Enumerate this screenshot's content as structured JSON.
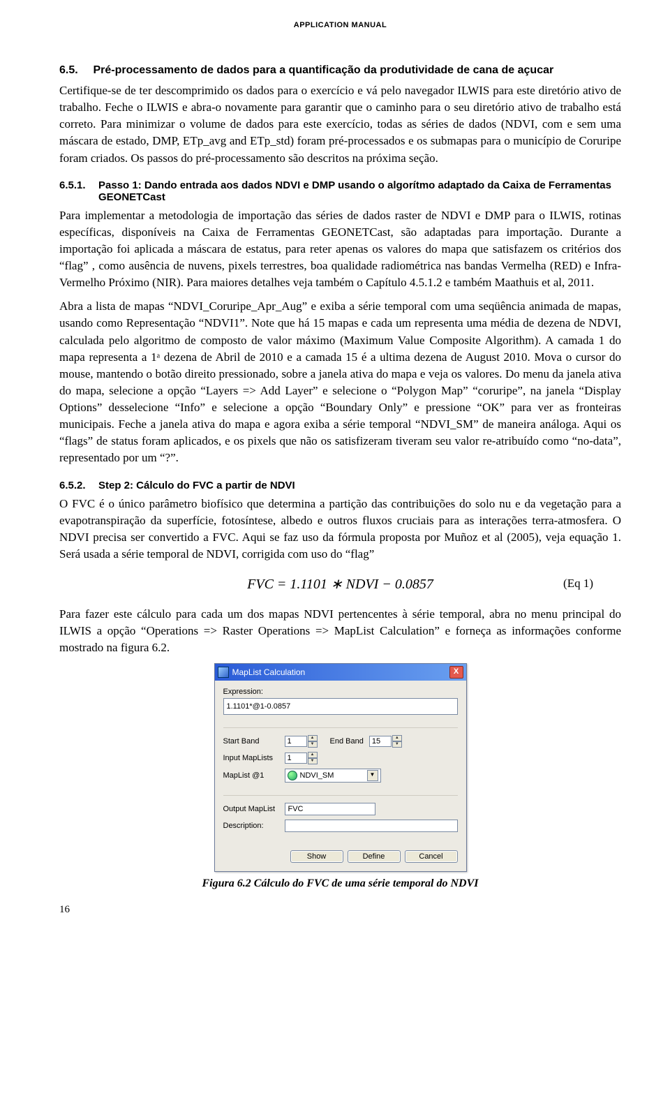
{
  "header": "APPLICATION MANUAL",
  "sec65_num": "6.5.",
  "sec65_title": "Pré-processamento de dados para a quantificação da produtividade de cana de açucar",
  "p65": "Certifique-se de ter descomprimido os dados para o exercício e vá pelo navegador ILWIS para este diretório ativo de trabalho. Feche o ILWIS e abra-o novamente para garantir que o caminho para o seu diretório ativo de trabalho está correto. Para minimizar o volume de dados para este exercício, todas as séries de dados (NDVI, com e sem uma máscara de estado, DMP, ETp_avg and ETp_std) foram pré-processados e os submapas para o município de Coruripe foram criados. Os passos do pré-processamento são descritos na próxima seção.",
  "sec651_num": "6.5.1.",
  "sec651_title": "Passo 1: Dando entrada aos dados NDVI e DMP usando o algorítmo adaptado da Caixa de Ferramentas GEONETCast",
  "p651a": "Para implementar a metodologia de importação das séries de dados raster de NDVI e DMP para o ILWIS, rotinas específicas, disponíveis na Caixa de Ferramentas GEONETCast, são adaptadas para importação. Durante a importação foi aplicada a máscara de estatus, para reter apenas os valores do mapa que satisfazem os critérios dos “flag” , como ausência de nuvens, pixels terrestres, boa qualidade radiométrica nas bandas Vermelha (RED) e Infra-Vermelho Próximo (NIR). Para maiores detalhes veja também o Capítulo 4.5.1.2 e também Maathuis et al, 2011.",
  "p651b": "Abra a lista de mapas “NDVI_Coruripe_Apr_Aug” e exiba a série temporal com uma seqüência animada de mapas, usando como Representação “NDVI1”. Note que há 15 mapas e cada um representa uma média de dezena de NDVI, calculada pelo algoritmo de composto de valor máximo (Maximum Value Composite Algorithm). A camada 1 do mapa representa a 1ᵃ dezena de Abril de 2010 e a camada 15 é a ultima dezena de August 2010. Mova o cursor do mouse, mantendo o botão direito pressionado, sobre a janela ativa do mapa e veja os valores. Do menu da janela ativa do mapa, selecione a opção “Layers => Add Layer” e selecione o “Polygon Map” “coruripe”, na janela “Display Options” desselecione “Info” e selecione a opção “Boundary Only” e pressione “OK” para ver as fronteiras municipais.  Feche a janela ativa do mapa e agora exiba a série temporal “NDVI_SM” de maneira análoga. Aqui os “flags” de status foram aplicados, e os pixels que não os satisfizeram tiveram seu valor re-atribuído como “no-data”, representado por um “?”.",
  "sec652_num": "6.5.2.",
  "sec652_title": "Step 2: Cálculo do FVC a partir de NDVI",
  "p652a": "O FVC é o único parâmetro biofísico que determina a partição das contribuições do solo nu e da vegetação para a evapotranspiração da superfície, fotosíntese, albedo e outros fluxos cruciais para as interações terra-atmosfera. O NDVI precisa ser convertido a FVC.  Aqui se faz uso da fórmula proposta por Muñoz et al (2005), veja equação 1. Será usada a série temporal de NDVI, corrigida com uso do “flag”",
  "eq1_text": "FVC = 1.1101 ∗ NDVI − 0.0857",
  "eq1_label": "(Eq 1)",
  "p652b": "Para fazer este cálculo para cada um dos mapas NDVI pertencentes à série temporal, abra no menu principal do ILWIS a opção “Operations => Raster Operations => MapList Calculation” e forneça as informações conforme mostrado na figura 6.2.",
  "dialog": {
    "title": "MapList Calculation",
    "lbl_expr": "Expression:",
    "expr": "1.1101*@1-0.0857",
    "lbl_start": "Start Band",
    "val_start": "1",
    "lbl_end": "End Band",
    "val_end": "15",
    "lbl_inputn": "Input MapLists",
    "val_inputn": "1",
    "lbl_ml1": "MapList @1",
    "val_ml1": "NDVI_SM",
    "lbl_out": "Output MapList",
    "val_out": "FVC",
    "lbl_desc": "Description:",
    "val_desc": "",
    "btn_show": "Show",
    "btn_define": "Define",
    "btn_cancel": "Cancel"
  },
  "caption": "Figura 6.2 Cálculo do FVC de uma série temporal do NDVI",
  "page_num": "16"
}
